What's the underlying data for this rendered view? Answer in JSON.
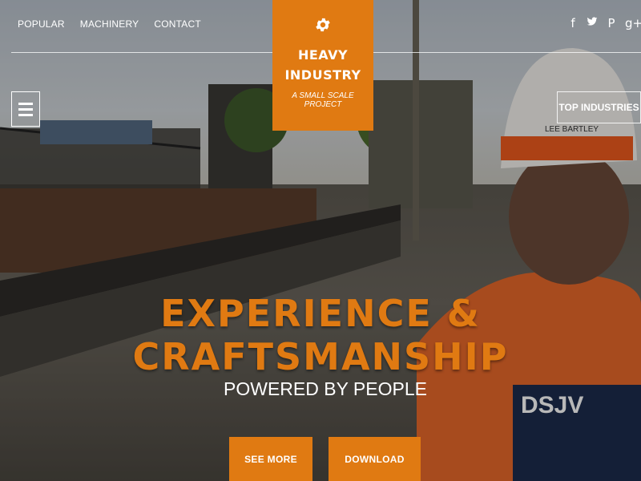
{
  "nav": {
    "items": [
      "POPULAR",
      "MACHINERY",
      "CONTACT"
    ]
  },
  "brand": {
    "icon": "gear-icon",
    "title_line1": "HEAVY",
    "title_line2": "INDUSTRY",
    "tagline": "A SMALL SCALE PROJECT",
    "accent_color": "#e07a12"
  },
  "social": {
    "facebook": "f",
    "twitter": "𝕥",
    "pinterest": "P",
    "googleplus": "g+"
  },
  "top_industries": {
    "label": "TOP INDUSTRIES"
  },
  "hero": {
    "headline": "EXPERIENCE & CRAFTSMANSHIP",
    "subheadline": "POWERED BY PEOPLE"
  },
  "buttons": {
    "see_more": "SEE MORE",
    "download": "DOWNLOAD"
  },
  "vest_text": "DSJV",
  "helmet_text": "LEE BARTLEY"
}
